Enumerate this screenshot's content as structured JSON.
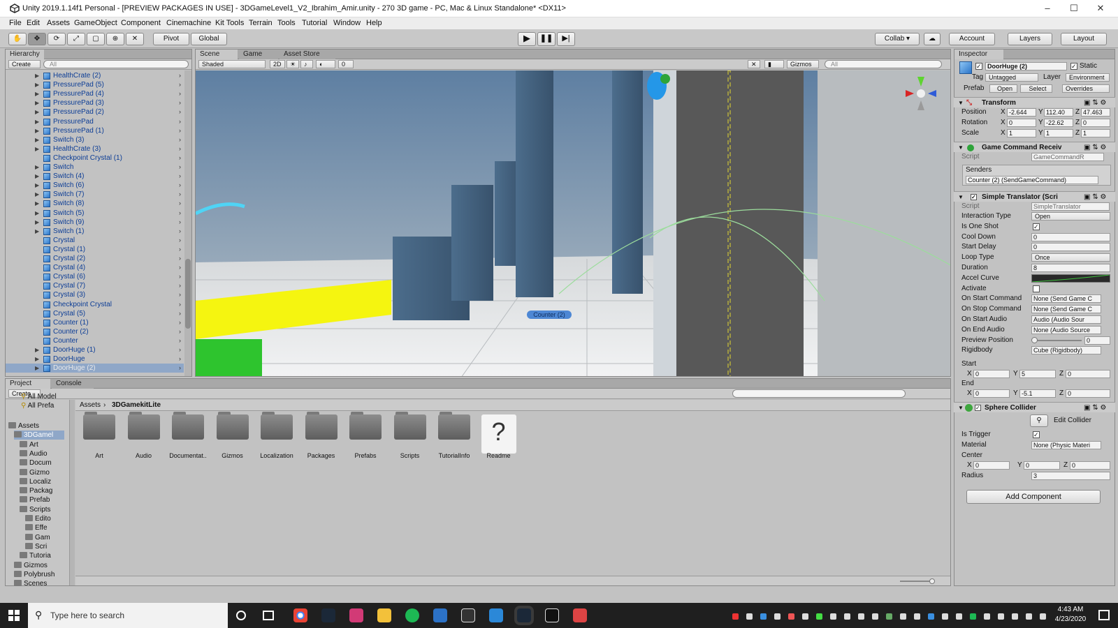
{
  "window": {
    "title": "Unity 2019.1.14f1 Personal - [PREVIEW PACKAGES IN USE] - 3DGameLevel1_V2_Ibrahim_Amir.unity - 270 3D game - PC, Mac & Linux Standalone* <DX11>",
    "minimize": "–",
    "maximize": "☐",
    "close": "✕"
  },
  "menu": [
    "File",
    "Edit",
    "Assets",
    "GameObject",
    "Component",
    "Cinemachine",
    "Kit Tools",
    "Terrain",
    "Tools",
    "Tutorial",
    "Window",
    "Help"
  ],
  "toolbar": {
    "pivot": "Pivot",
    "global": "Global",
    "collab": "Collab ▾",
    "account": "Account",
    "layers": "Layers",
    "layout": "Layout"
  },
  "hierarchy": {
    "tab": "Hierarchy",
    "create": "Create",
    "search_placeholder": "All",
    "items": [
      {
        "label": "HealthCrate (2)",
        "arrow": true
      },
      {
        "label": "PressurePad (5)",
        "arrow": true
      },
      {
        "label": "PressurePad (4)",
        "arrow": true
      },
      {
        "label": "PressurePad (3)",
        "arrow": true
      },
      {
        "label": "PressurePad (2)",
        "arrow": true
      },
      {
        "label": "PressurePad",
        "arrow": true
      },
      {
        "label": "PressurePad (1)",
        "arrow": true
      },
      {
        "label": "Switch (3)",
        "arrow": true
      },
      {
        "label": "HealthCrate (3)",
        "arrow": true
      },
      {
        "label": "Checkpoint Crystal (1)",
        "arrow": false
      },
      {
        "label": "Switch",
        "arrow": true
      },
      {
        "label": "Switch (4)",
        "arrow": true
      },
      {
        "label": "Switch (6)",
        "arrow": true
      },
      {
        "label": "Switch (7)",
        "arrow": true
      },
      {
        "label": "Switch (8)",
        "arrow": true
      },
      {
        "label": "Switch (5)",
        "arrow": true
      },
      {
        "label": "Switch (9)",
        "arrow": true
      },
      {
        "label": "Switch (1)",
        "arrow": true
      },
      {
        "label": "Crystal",
        "arrow": false
      },
      {
        "label": "Crystal (1)",
        "arrow": false
      },
      {
        "label": "Crystal (2)",
        "arrow": false
      },
      {
        "label": "Crystal (4)",
        "arrow": false
      },
      {
        "label": "Crystal (6)",
        "arrow": false
      },
      {
        "label": "Crystal (7)",
        "arrow": false
      },
      {
        "label": "Crystal (3)",
        "arrow": false
      },
      {
        "label": "Checkpoint Crystal",
        "arrow": false
      },
      {
        "label": "Crystal (5)",
        "arrow": false
      },
      {
        "label": "Counter (1)",
        "arrow": false
      },
      {
        "label": "Counter (2)",
        "arrow": false
      },
      {
        "label": "Counter",
        "arrow": false
      },
      {
        "label": "DoorHuge (1)",
        "arrow": true
      },
      {
        "label": "DoorHuge",
        "arrow": true
      },
      {
        "label": "DoorHuge (2)",
        "arrow": true
      }
    ]
  },
  "scene": {
    "tabs": [
      "Scene",
      "Game",
      "Asset Store"
    ],
    "shading": "Shaded",
    "mode_2d": "2D",
    "hidden_count": "0",
    "gizmos": "Gizmos",
    "search_placeholder": "All",
    "selected_label": "Counter (2)"
  },
  "inspector": {
    "tab": "Inspector",
    "object_name": "DoorHuge (2)",
    "static_label": "Static",
    "tag_label": "Tag",
    "tag_value": "Untagged",
    "layer_label": "Layer",
    "layer_value": "Environment",
    "prefab_label": "Prefab",
    "prefab_open": "Open",
    "prefab_select": "Select",
    "prefab_overrides": "Overrides",
    "transform": {
      "title": "Transform",
      "position_label": "Position",
      "position": {
        "x": "-2.644",
        "y": "112.40",
        "z": "47.463"
      },
      "rotation_label": "Rotation",
      "rotation": {
        "x": "0",
        "y": "-22.62",
        "z": "0"
      },
      "scale_label": "Scale",
      "scale": {
        "x": "1",
        "y": "1",
        "z": "1"
      }
    },
    "game_command": {
      "title": "Game Command Receiv",
      "script_label": "Script",
      "script_value": "GameCommandR",
      "senders_label": "Senders",
      "sender": "Counter (2) (SendGameCommand)"
    },
    "simple_translator": {
      "title": "Simple Translator (Scri",
      "script_label": "Script",
      "script_value": "SimpleTranslator",
      "rows": [
        {
          "label": "Interaction Type",
          "value": "Open",
          "kind": "dropdown"
        },
        {
          "label": "Is One Shot",
          "value": "✓",
          "kind": "check"
        },
        {
          "label": "Cool Down",
          "value": "0",
          "kind": "field"
        },
        {
          "label": "Start Delay",
          "value": "0",
          "kind": "field"
        },
        {
          "label": "Loop Type",
          "value": "Once",
          "kind": "dropdown"
        },
        {
          "label": "Duration",
          "value": "8",
          "kind": "field"
        },
        {
          "label": "Accel Curve",
          "value": "",
          "kind": "curve"
        },
        {
          "label": "Activate",
          "value": "",
          "kind": "check"
        },
        {
          "label": "On Start Command",
          "value": "None (Send Game C",
          "kind": "obj"
        },
        {
          "label": "On Stop Command",
          "value": "None (Send Game C",
          "kind": "obj"
        },
        {
          "label": "On Start Audio",
          "value": "Audio (Audio Sour",
          "kind": "obj"
        },
        {
          "label": "On End Audio",
          "value": "None (Audio Source",
          "kind": "obj"
        },
        {
          "label": "Preview Position",
          "value": "0",
          "kind": "slider"
        },
        {
          "label": "Rigidbody",
          "value": "Cube (Rigidbody)",
          "kind": "obj"
        }
      ],
      "start_label": "Start",
      "start": {
        "x": "0",
        "y": "5",
        "z": "0"
      },
      "end_label": "End",
      "end": {
        "x": "0",
        "y": "-5.1",
        "z": "0"
      }
    },
    "sphere_collider": {
      "title": "Sphere Collider",
      "edit_collider": "Edit Collider",
      "is_trigger_label": "Is Trigger",
      "is_trigger": "✓",
      "material_label": "Material",
      "material_value": "None (Physic Materi",
      "center_label": "Center",
      "center": {
        "x": "0",
        "y": "0",
        "z": "0"
      },
      "radius_label": "Radius",
      "radius": "3"
    },
    "add_component": "Add Component"
  },
  "project": {
    "tabs": [
      "Project",
      "Console"
    ],
    "create": "Create",
    "favorites": [
      "All Model",
      "All Prefa"
    ],
    "breadcrumb": [
      "Assets",
      "3DGamekitLite"
    ],
    "tree": [
      {
        "label": "Assets",
        "indent": 0
      },
      {
        "label": "3DGamel",
        "indent": 1
      },
      {
        "label": "Art",
        "indent": 2
      },
      {
        "label": "Audio",
        "indent": 2
      },
      {
        "label": "Docum",
        "indent": 2
      },
      {
        "label": "Gizmo",
        "indent": 2
      },
      {
        "label": "Localiz",
        "indent": 2
      },
      {
        "label": "Packag",
        "indent": 2
      },
      {
        "label": "Prefab",
        "indent": 2
      },
      {
        "label": "Scripts",
        "indent": 2
      },
      {
        "label": "Edito",
        "indent": 3
      },
      {
        "label": "Effe",
        "indent": 3
      },
      {
        "label": "Gam",
        "indent": 3
      },
      {
        "label": "Scri",
        "indent": 3
      },
      {
        "label": "Tutoria",
        "indent": 2
      },
      {
        "label": "Gizmos",
        "indent": 1
      },
      {
        "label": "Polybrush",
        "indent": 1
      },
      {
        "label": "Scenes",
        "indent": 1
      }
    ],
    "folders": [
      "Art",
      "Audio",
      "Documentat..",
      "Gizmos",
      "Localization",
      "Packages",
      "Prefabs",
      "Scripts",
      "TutorialInfo",
      "Readme"
    ]
  },
  "taskbar": {
    "search_placeholder": "Type here to search",
    "time": "4:43 AM",
    "date": "4/23/2020"
  }
}
